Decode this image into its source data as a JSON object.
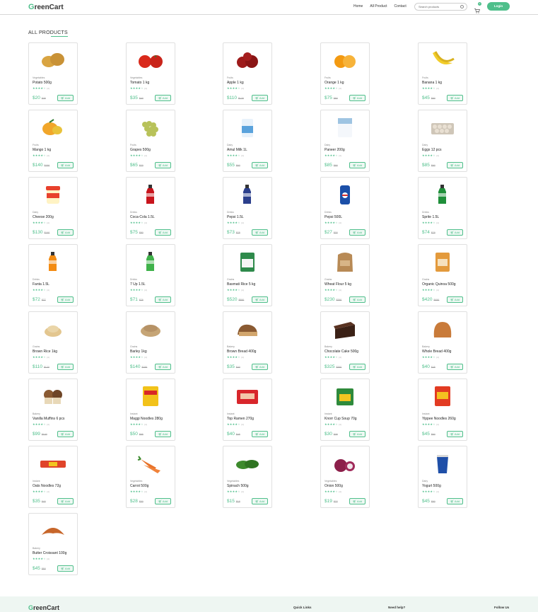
{
  "header": {
    "logo_mark": "G",
    "logo_text": "reenCart",
    "nav": [
      "Home",
      "All Product",
      "Contact"
    ],
    "search_placeholder": "Search products",
    "cart_count": "0",
    "login_label": "Login"
  },
  "section_title": "ALL PRODUCTS",
  "add_label": "Add",
  "products": [
    {
      "cat": "Vegetables",
      "name": "Potato 500g",
      "rating": "(4)",
      "price": "$20",
      "old": "$25",
      "icon": "potato",
      "color": "#d9a441"
    },
    {
      "cat": "Vegetables",
      "name": "Tomato 1 kg",
      "rating": "(4)",
      "price": "$35",
      "old": "$40",
      "icon": "tomato",
      "color": "#d9291b"
    },
    {
      "cat": "Fruits",
      "name": "Apple 1 kg",
      "rating": "(4)",
      "price": "$110",
      "old": "$120",
      "icon": "apple",
      "color": "#9e1b1b"
    },
    {
      "cat": "Fruits",
      "name": "Orange 1 kg",
      "rating": "(4)",
      "price": "$75",
      "old": "$80",
      "icon": "orange",
      "color": "#f39a12"
    },
    {
      "cat": "Fruits",
      "name": "Banana 1 kg",
      "rating": "(4)",
      "price": "$45",
      "old": "$50",
      "icon": "banana",
      "color": "#f2cd2a"
    },
    {
      "cat": "Fruits",
      "name": "Mango 1 kg",
      "rating": "(4)",
      "price": "$140",
      "old": "$150",
      "icon": "mango",
      "color": "#f1a62a"
    },
    {
      "cat": "Fruits",
      "name": "Grapes 500g",
      "rating": "(4)",
      "price": "$65",
      "old": "$70",
      "icon": "grapes",
      "color": "#b8c25a"
    },
    {
      "cat": "Dairy",
      "name": "Amul Milk 1L",
      "rating": "(4)",
      "price": "$55",
      "old": "$60",
      "icon": "milk",
      "color": "#5aa2dc"
    },
    {
      "cat": "Dairy",
      "name": "Paneer 200g",
      "rating": "(4)",
      "price": "$85",
      "old": "$90",
      "icon": "paneer",
      "color": "#9ec4e2"
    },
    {
      "cat": "Dairy",
      "name": "Eggs 12 pcs",
      "rating": "(4)",
      "price": "$85",
      "old": "$90",
      "icon": "eggs",
      "color": "#e9e0d3"
    },
    {
      "cat": "Dairy",
      "name": "Cheese 200g",
      "rating": "(4)",
      "price": "$130",
      "old": "$140",
      "icon": "cheese",
      "color": "#e8412c"
    },
    {
      "cat": "Drinks",
      "name": "Coca-Cola 1.5L",
      "rating": "(4)",
      "price": "$75",
      "old": "$80",
      "icon": "coke",
      "color": "#c8141c"
    },
    {
      "cat": "Drinks",
      "name": "Pepsi 1.5L",
      "rating": "(4)",
      "price": "$73",
      "old": "$78",
      "icon": "pepsi-bottle",
      "color": "#2b3f8c"
    },
    {
      "cat": "Drinks",
      "name": "Pepsi 500L",
      "rating": "(4)",
      "price": "$27",
      "old": "$30",
      "icon": "pepsi-can",
      "color": "#1b4fa8"
    },
    {
      "cat": "Drinks",
      "name": "Sprite 1.5L",
      "rating": "(4)",
      "price": "$74",
      "old": "$79",
      "icon": "sprite",
      "color": "#1f8f3a"
    },
    {
      "cat": "Drinks",
      "name": "Fanta 1.5L",
      "rating": "(4)",
      "price": "$72",
      "old": "$77",
      "icon": "fanta",
      "color": "#f38b12"
    },
    {
      "cat": "Drinks",
      "name": "7 Up 1.5L",
      "rating": "(4)",
      "price": "$71",
      "old": "$76",
      "icon": "sevenup",
      "color": "#3fb24a"
    },
    {
      "cat": "Grains",
      "name": "Basmati Rice 5 kg",
      "rating": "(4)",
      "price": "$520",
      "old": "$550",
      "icon": "rice-bag",
      "color": "#2e8a4b"
    },
    {
      "cat": "Grains",
      "name": "Wheat Flour 5 kg",
      "rating": "(4)",
      "price": "$230",
      "old": "$250",
      "icon": "flour-bag",
      "color": "#b88a55"
    },
    {
      "cat": "Grains",
      "name": "Organic Quinoa 500g",
      "rating": "(4)",
      "price": "$420",
      "old": "$450",
      "icon": "quinoa",
      "color": "#e39a3c"
    },
    {
      "cat": "Grains",
      "name": "Brown Rice 1kg",
      "rating": "(4)",
      "price": "$110",
      "old": "$120",
      "icon": "brown-rice",
      "color": "#e3c68f"
    },
    {
      "cat": "Grains",
      "name": "Barley 1kg",
      "rating": "(4)",
      "price": "$140",
      "old": "$150",
      "icon": "barley",
      "color": "#c6a576"
    },
    {
      "cat": "Bakery",
      "name": "Brown Bread 400g",
      "rating": "(4)",
      "price": "$35",
      "old": "$40",
      "icon": "bread",
      "color": "#8a5a32"
    },
    {
      "cat": "Bakery",
      "name": "Chocolate Cake 500g",
      "rating": "(4)",
      "price": "$325",
      "old": "$350",
      "icon": "cake",
      "color": "#3b2116"
    },
    {
      "cat": "Bakery",
      "name": "Whole Bread 400g",
      "rating": "(4)",
      "price": "$40",
      "old": "$45",
      "icon": "loaf",
      "color": "#c97b3a"
    },
    {
      "cat": "Bakery",
      "name": "Vanilla Muffins 6 pcs",
      "rating": "(4)",
      "price": "$99",
      "old": "$100",
      "icon": "muffins",
      "color": "#8a5a32"
    },
    {
      "cat": "Instant",
      "name": "Maggi Noodles 280g",
      "rating": "(4)",
      "price": "$50",
      "old": "$55",
      "icon": "maggi",
      "color": "#f2c21a"
    },
    {
      "cat": "Instant",
      "name": "Top Ramen 270g",
      "rating": "(4)",
      "price": "$40",
      "old": "$45",
      "icon": "ramen",
      "color": "#d8262b"
    },
    {
      "cat": "Instant",
      "name": "Knorr Cup Soup 70g",
      "rating": "(4)",
      "price": "$30",
      "old": "$35",
      "icon": "knorr",
      "color": "#2e8a3b"
    },
    {
      "cat": "Instant",
      "name": "Yippee Noodles 260g",
      "rating": "(4)",
      "price": "$45",
      "old": "$50",
      "icon": "yippee",
      "color": "#e23b22"
    },
    {
      "cat": "Instant",
      "name": "Oats Noodles 72g",
      "rating": "(4)",
      "price": "$35",
      "old": "$40",
      "icon": "oats",
      "color": "#e0442a"
    },
    {
      "cat": "Vegetables",
      "name": "Carrot 500g",
      "rating": "(4)",
      "price": "$28",
      "old": "$30",
      "icon": "carrot",
      "color": "#e8732a"
    },
    {
      "cat": "Vegetables",
      "name": "Spinach 500g",
      "rating": "(4)",
      "price": "$15",
      "old": "$18",
      "icon": "spinach",
      "color": "#3d8a2c"
    },
    {
      "cat": "Vegetables",
      "name": "Onion 500g",
      "rating": "(4)",
      "price": "$19",
      "old": "$22",
      "icon": "onion",
      "color": "#8c1f4a"
    },
    {
      "cat": "Dairy",
      "name": "Yogurt 500g",
      "rating": "(4)",
      "price": "$45",
      "old": "$50",
      "icon": "yogurt",
      "color": "#1f4fa8"
    },
    {
      "cat": "Bakery",
      "name": "Butter Croissant 100g",
      "rating": "(4)",
      "price": "$45",
      "old": "$50",
      "icon": "croissant",
      "color": "#c7662a"
    }
  ],
  "footer": {
    "logo_mark": "G",
    "logo_text": "reenCart",
    "col1": "Quick Links",
    "col2": "Need help?",
    "col3": "Follow Us"
  },
  "colors": {
    "accent": "#4fbf8b"
  }
}
